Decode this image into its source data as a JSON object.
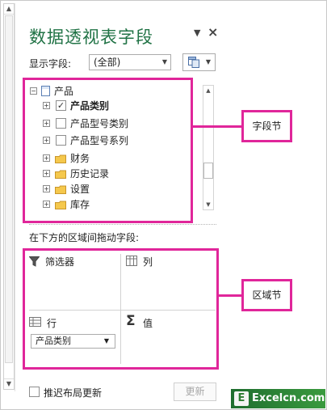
{
  "pane": {
    "title": "数据透视表字段",
    "close_glyph": "×",
    "caret_glyph": "▼"
  },
  "show_fields": {
    "label": "显示字段:",
    "selected": "(全部)"
  },
  "field_list": {
    "root": "产品",
    "items": [
      {
        "label": "产品类别",
        "checked": true,
        "bold": true,
        "kind": "field"
      },
      {
        "label": "产品型号类别",
        "checked": false,
        "bold": false,
        "kind": "field"
      },
      {
        "label": "产品型号系列",
        "checked": false,
        "bold": false,
        "kind": "field"
      },
      {
        "label": "财务",
        "kind": "folder"
      },
      {
        "label": "历史记录",
        "kind": "folder"
      },
      {
        "label": "设置",
        "kind": "folder"
      },
      {
        "label": "库存",
        "kind": "folder"
      }
    ]
  },
  "areas": {
    "drag_label": "在下方的区域间拖动字段:",
    "filters": "筛选器",
    "columns": "列",
    "rows": "行",
    "values": "值",
    "rows_field": "产品类别"
  },
  "footer": {
    "defer_label": "推迟布局更新",
    "update_label": "更新"
  },
  "callouts": {
    "field_section": "字段节",
    "area_section": "区域节"
  },
  "branding": {
    "badge": "E",
    "text": "Excelcn.com"
  },
  "colors": {
    "title": "#217346",
    "highlight": "#e0269a"
  }
}
